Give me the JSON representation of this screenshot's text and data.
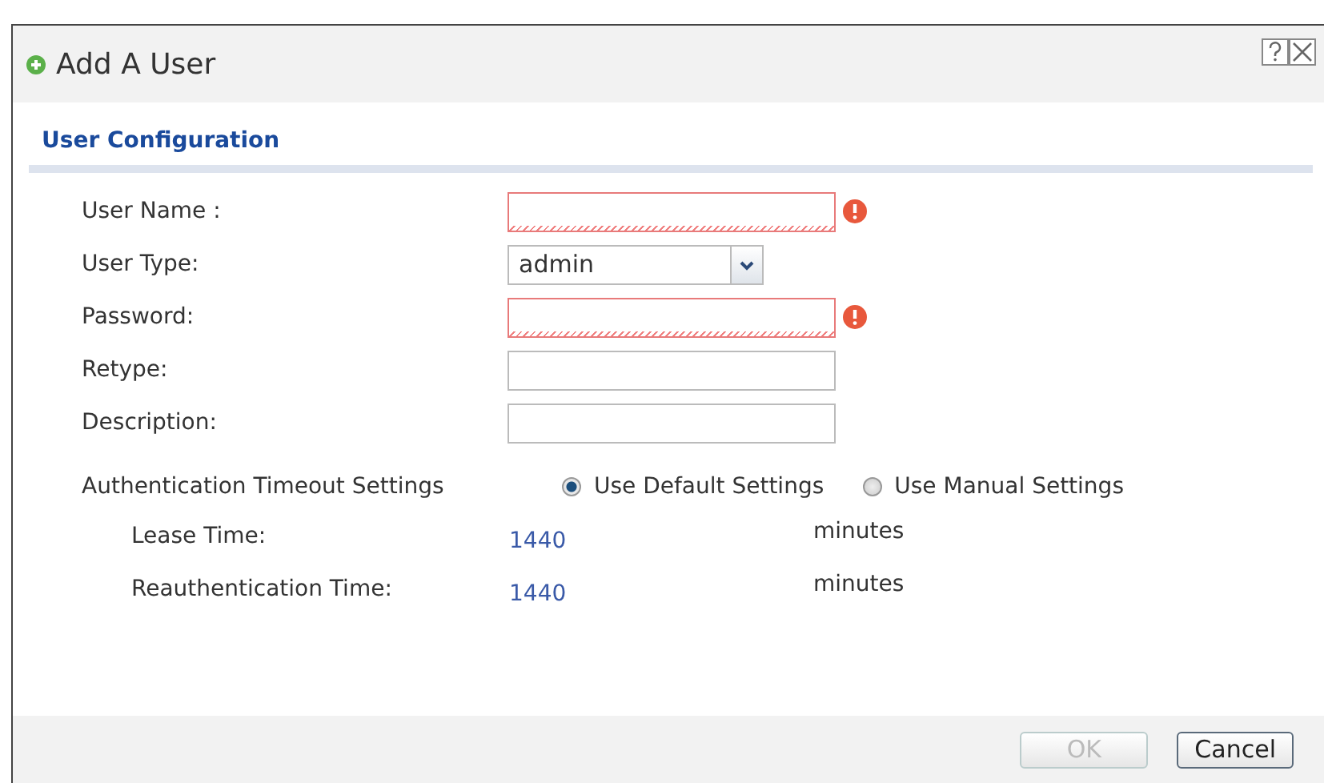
{
  "window": {
    "title": "Add A User"
  },
  "section": {
    "title": "User Configuration"
  },
  "fields": [
    {
      "label": "User Name :",
      "kind": "text",
      "invalid": true
    },
    {
      "label": "User Type:",
      "kind": "select",
      "value": "admin",
      "invalid": false
    },
    {
      "label": "Password:",
      "kind": "text",
      "invalid": true
    },
    {
      "label": "Retype:",
      "kind": "text",
      "invalid": false
    },
    {
      "label": "Description:",
      "kind": "text",
      "invalid": false
    }
  ],
  "timeout": {
    "label": "Authentication Timeout Settings",
    "options": [
      {
        "label": "Use Default Settings",
        "selected": true
      },
      {
        "label": "Use Manual Settings",
        "selected": false
      }
    ],
    "rows": [
      {
        "label": "Lease Time:",
        "value": "1440",
        "unit": "minutes"
      },
      {
        "label": "Reauthentication Time:",
        "value": "1440",
        "unit": "minutes"
      }
    ]
  },
  "buttons": [
    {
      "label": "OK",
      "disabled": true
    },
    {
      "label": "Cancel",
      "disabled": false
    }
  ]
}
